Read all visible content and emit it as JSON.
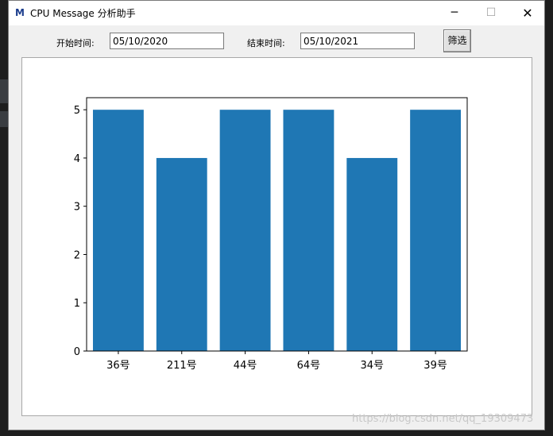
{
  "window": {
    "title": "CPU Message 分析助手",
    "controls": {
      "minimize": "─",
      "maximize": "☐",
      "close": "✕"
    }
  },
  "filter": {
    "start_label": "开始时间:",
    "start_value": "05/10/2020",
    "end_label": "结束时间:",
    "end_value": "05/10/2021",
    "button_label": "筛选"
  },
  "chart_data": {
    "type": "bar",
    "title": "",
    "categories": [
      "36号",
      "211号",
      "44号",
      "64号",
      "34号",
      "39号"
    ],
    "values": [
      5,
      4,
      5,
      5,
      4,
      5
    ],
    "ylim": [
      0,
      5.25
    ],
    "yticks": [
      0,
      1,
      2,
      3,
      4,
      5
    ],
    "xlabel": "",
    "ylabel": "",
    "bar_color": "#1f77b4",
    "grid": false
  },
  "watermark": "https://blog.csdn.net/qq_19309473",
  "colors": {
    "accent": "#1f77b4",
    "window_bg": "#f0f0f0"
  }
}
